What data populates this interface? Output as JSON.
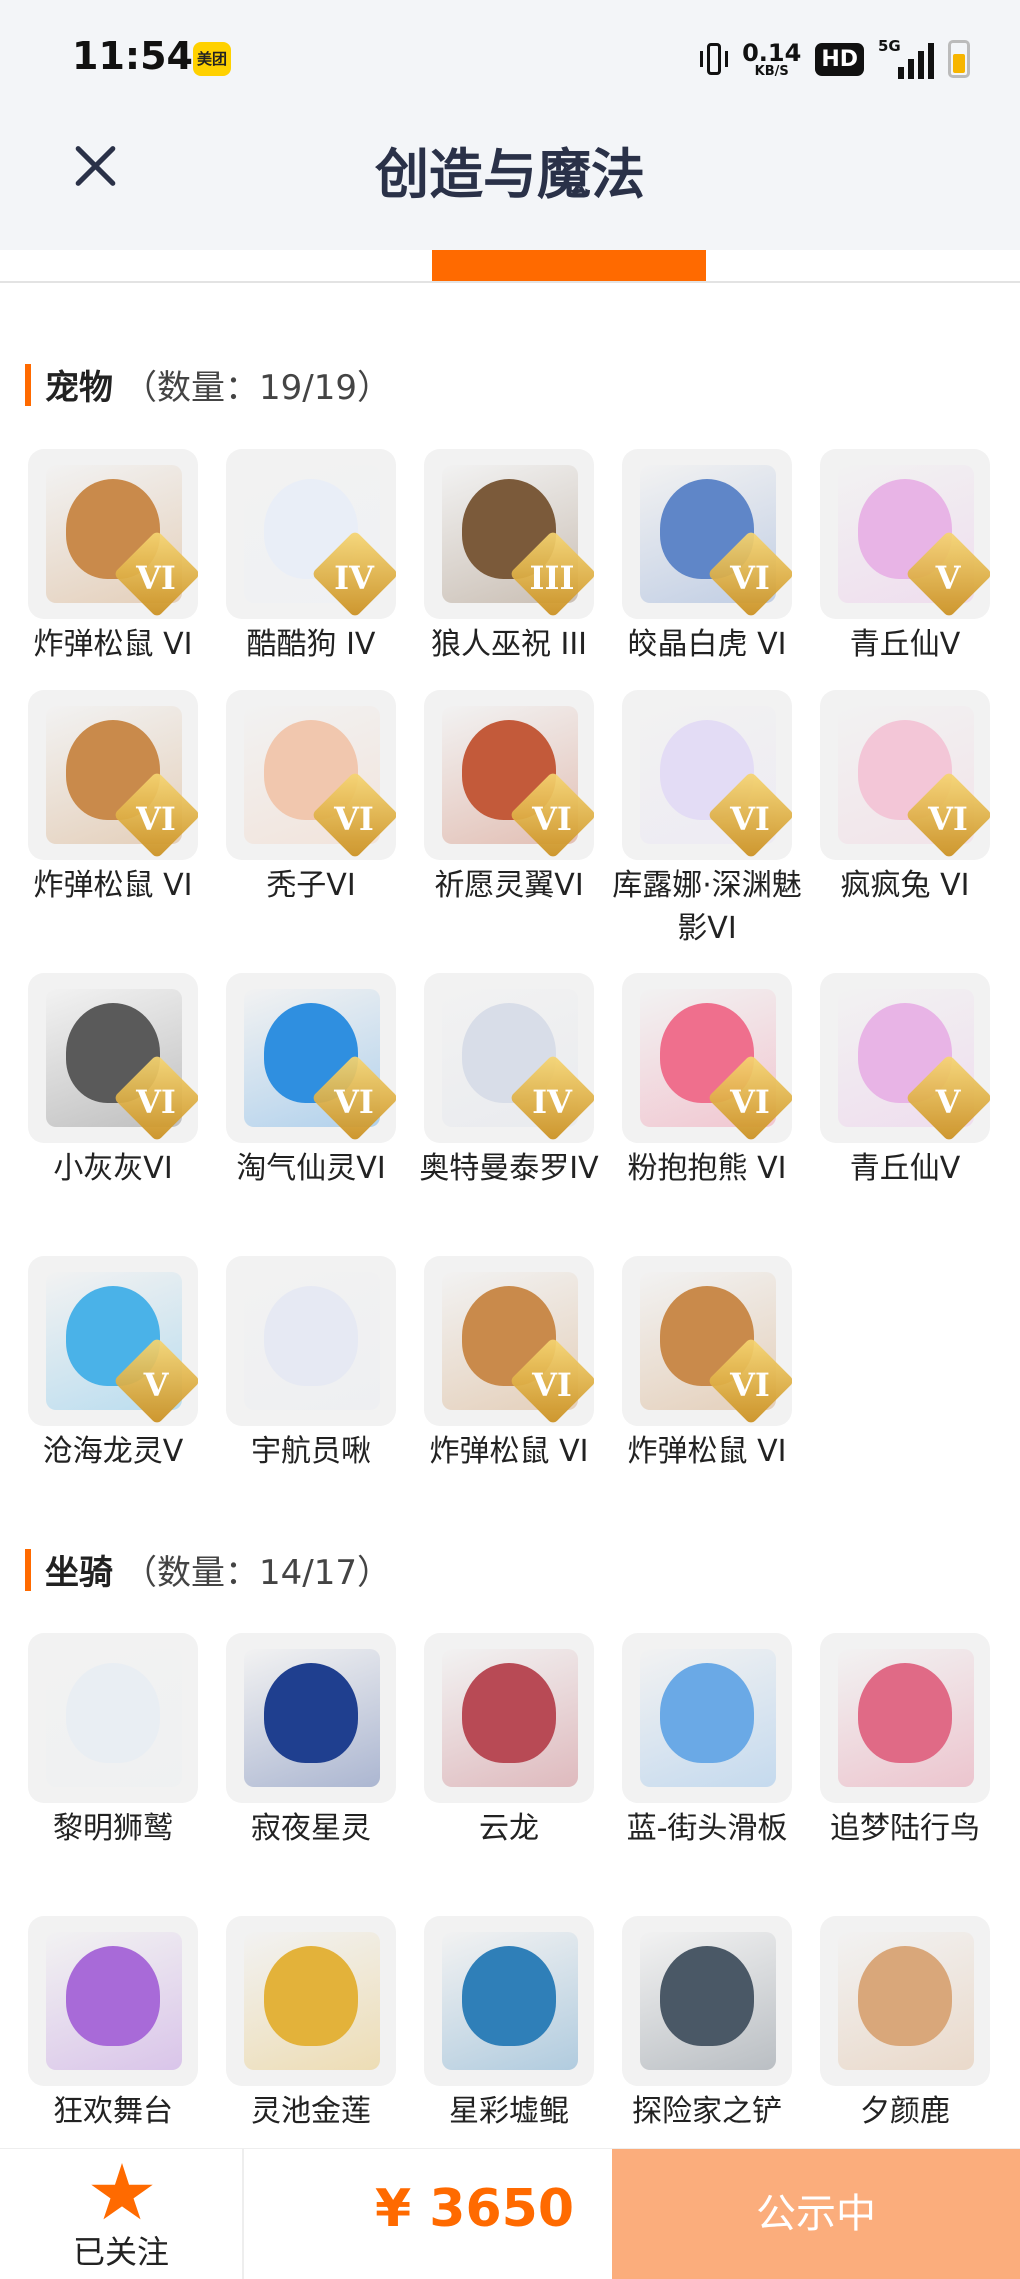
{
  "status_bar": {
    "time": "11:54",
    "app_badge": "美团",
    "net_speed_value": "0.14",
    "net_speed_unit": "KB/S",
    "hd": "HD",
    "signal": "5G"
  },
  "header": {
    "title": "创造与魔法"
  },
  "pets": {
    "name": "宠物",
    "count": "（数量：19/19）",
    "items": [
      {
        "label": "炸弹松鼠 VI",
        "tier": "VI",
        "color": "#c98a4b"
      },
      {
        "label": "酷酷狗 IV",
        "tier": "IV",
        "color": "#e9eef7"
      },
      {
        "label": "狼人巫祝 III",
        "tier": "III",
        "color": "#7b5a3a"
      },
      {
        "label": "皎晶白虎 VI",
        "tier": "VI",
        "color": "#5f86c8"
      },
      {
        "label": "青丘仙V",
        "tier": "V",
        "color": "#e8b4e6"
      },
      {
        "label": "炸弹松鼠 VI",
        "tier": "VI",
        "color": "#c98a4b"
      },
      {
        "label": "秃子VI",
        "tier": "VI",
        "color": "#f1c7ae"
      },
      {
        "label": "祈愿灵翼VI",
        "tier": "VI",
        "color": "#c35a3a"
      },
      {
        "label": "库露娜·深渊魅影VI",
        "tier": "VI",
        "color": "#e3dcf5"
      },
      {
        "label": "疯疯兔 VI",
        "tier": "VI",
        "color": "#f3c6d7"
      },
      {
        "label": "小灰灰VI",
        "tier": "VI",
        "color": "#5a5a5a"
      },
      {
        "label": "淘气仙灵VI",
        "tier": "VI",
        "color": "#2f8fe0"
      },
      {
        "label": "奥特曼泰罗IV",
        "tier": "IV",
        "color": "#d8dde8"
      },
      {
        "label": "粉抱抱熊 VI",
        "tier": "VI",
        "color": "#ef6f8d"
      },
      {
        "label": "青丘仙V",
        "tier": "V",
        "color": "#e8b4e6"
      },
      {
        "label": "沧海龙灵V",
        "tier": "V",
        "color": "#4ab2e8"
      },
      {
        "label": "宇航员啾",
        "tier": "",
        "color": "#e6e9f3"
      },
      {
        "label": "炸弹松鼠 VI",
        "tier": "VI",
        "color": "#c98a4b"
      },
      {
        "label": "炸弹松鼠 VI",
        "tier": "VI",
        "color": "#c98a4b"
      }
    ]
  },
  "mounts": {
    "name": "坐骑",
    "count": "（数量：14/17）",
    "items": [
      {
        "label": "黎明狮鹫",
        "color": "#e9eef3"
      },
      {
        "label": "寂夜星灵",
        "color": "#1f3f8f"
      },
      {
        "label": "云龙",
        "color": "#b84a55"
      },
      {
        "label": "蓝-街头滑板",
        "color": "#6aa9e6"
      },
      {
        "label": "追梦陆行鸟",
        "color": "#e06a86"
      },
      {
        "label": "狂欢舞台",
        "color": "#a86ad8"
      },
      {
        "label": "灵池金莲",
        "color": "#e3b23a"
      },
      {
        "label": "星彩墟鲲",
        "color": "#2f7fb8"
      },
      {
        "label": "探险家之铲",
        "color": "#4a5866"
      },
      {
        "label": "夕颜鹿",
        "color": "#d9a77a"
      }
    ]
  },
  "bottom_bar": {
    "follow_label": "已关注",
    "price": "¥ 3650",
    "status_button": "公示中"
  }
}
